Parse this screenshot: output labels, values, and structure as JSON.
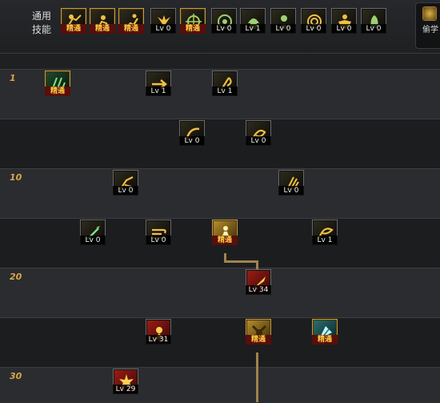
{
  "common": {
    "label": "通用技能",
    "skills": [
      {
        "icon": "scroll-reader-icon",
        "level": "精通",
        "mastered": true
      },
      {
        "icon": "crouch-warrior-icon",
        "level": "精通",
        "mastered": true
      },
      {
        "icon": "running-figure-icon",
        "level": "精通",
        "mastered": true
      },
      {
        "icon": "wings-icon",
        "level": "Lv 0",
        "mastered": false
      },
      {
        "icon": "crosshair-icon",
        "level": "精通",
        "mastered": true
      },
      {
        "icon": "target-reticle-icon",
        "level": "Lv 0",
        "mastered": false
      },
      {
        "icon": "helmet-soldier-icon",
        "level": "Lv 1",
        "mastered": false
      },
      {
        "icon": "soldier-bust-icon",
        "level": "Lv 0",
        "mastered": false
      },
      {
        "icon": "swirl-orb-icon",
        "level": "Lv 0",
        "mastered": false
      },
      {
        "icon": "muscle-figure-icon",
        "level": "Lv 0",
        "mastered": false
      },
      {
        "icon": "ghost-figure-icon",
        "level": "Lv 0",
        "mastered": false
      }
    ]
  },
  "right_panel": {
    "label": "偷学"
  },
  "tree": {
    "level_labels": [
      "1",
      "10",
      "20",
      "30"
    ],
    "rows": [
      {
        "skills": [
          {
            "icon": "green-rune-icon",
            "level": "精通",
            "mastered": true,
            "style": "green"
          },
          {
            "icon": "dash-arrow-icon",
            "level": "Lv 1",
            "mastered": false,
            "style": ""
          },
          {
            "icon": "scythe-icon",
            "level": "Lv 1",
            "mastered": false,
            "style": ""
          }
        ]
      },
      {
        "skills": [
          {
            "icon": "slash-arc-icon",
            "level": "Lv 0",
            "mastered": false,
            "style": ""
          },
          {
            "icon": "spiral-slash-icon",
            "level": "Lv 0",
            "mastered": false,
            "style": ""
          }
        ]
      },
      {
        "skills": [
          {
            "icon": "leaping-strike-icon",
            "level": "Lv 0",
            "mastered": false,
            "style": ""
          },
          {
            "icon": "triple-claw-icon",
            "level": "Lv 0",
            "mastered": false,
            "style": ""
          }
        ]
      },
      {
        "skills": [
          {
            "icon": "green-spear-icon",
            "level": "Lv 0",
            "mastered": false,
            "style": ""
          },
          {
            "icon": "wind-rush-icon",
            "level": "Lv 0",
            "mastered": false,
            "style": ""
          },
          {
            "icon": "golden-warrior-icon",
            "level": "精通",
            "mastered": true,
            "style": "gold"
          },
          {
            "icon": "whirlwind-icon",
            "level": "Lv 1",
            "mastered": false,
            "style": ""
          }
        ]
      },
      {
        "skills": [
          {
            "icon": "red-blade-icon",
            "level": "Lv 34",
            "mastered": false,
            "style": "red"
          }
        ]
      },
      {
        "skills": [
          {
            "icon": "red-fury-icon",
            "level": "Lv 31",
            "mastered": false,
            "style": "red"
          },
          {
            "icon": "golden-storm-icon",
            "level": "精通",
            "mastered": true,
            "style": "gold"
          },
          {
            "icon": "ice-shard-icon",
            "level": "精通",
            "mastered": true,
            "style": "teal"
          }
        ]
      },
      {
        "skills": [
          {
            "icon": "red-explosion-icon",
            "level": "Lv 29",
            "mastered": false,
            "style": "red"
          }
        ]
      }
    ]
  }
}
